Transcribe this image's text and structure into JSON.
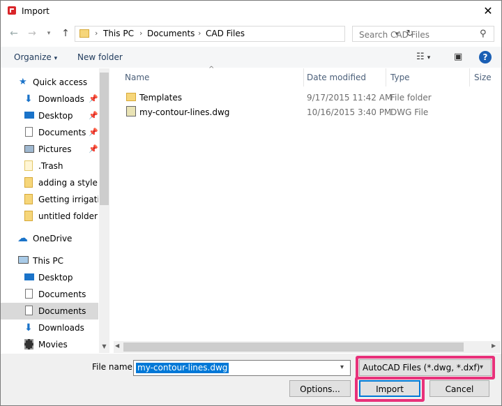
{
  "window": {
    "title": "Import"
  },
  "nav": {
    "breadcrumb": [
      "This PC",
      "Documents",
      "CAD Files"
    ],
    "search_placeholder": "Search CAD Files"
  },
  "toolbar": {
    "organize": "Organize",
    "new_folder": "New folder"
  },
  "sidebar": {
    "items": [
      {
        "label": "Quick access",
        "icon": "star-icon"
      },
      {
        "label": "Downloads",
        "icon": "download-arrow-icon",
        "pinned": true
      },
      {
        "label": "Desktop",
        "icon": "desktop-icon",
        "pinned": true
      },
      {
        "label": "Documents",
        "icon": "document-icon",
        "pinned": true
      },
      {
        "label": "Pictures",
        "icon": "picture-icon",
        "pinned": true
      },
      {
        "label": ".Trash",
        "icon": "folder-icon"
      },
      {
        "label": "adding a style in",
        "icon": "folder-icon"
      },
      {
        "label": "Getting irrigation",
        "icon": "folder-icon"
      },
      {
        "label": "untitled folder",
        "icon": "folder-icon"
      },
      {
        "label": "OneDrive",
        "icon": "cloud-icon"
      },
      {
        "label": "This PC",
        "icon": "computer-icon"
      },
      {
        "label": "Desktop",
        "icon": "desktop-icon"
      },
      {
        "label": "Documents",
        "icon": "document-icon"
      },
      {
        "label": "Documents",
        "icon": "document-icon",
        "selected": true
      },
      {
        "label": "Downloads",
        "icon": "download-arrow-icon"
      },
      {
        "label": "Movies",
        "icon": "film-icon"
      }
    ]
  },
  "columns": {
    "name": "Name",
    "date": "Date modified",
    "type": "Type",
    "size": "Size"
  },
  "files": [
    {
      "name": "Templates",
      "date": "9/17/2015 11:42 AM",
      "type": "File folder",
      "icon": "folder-icon"
    },
    {
      "name": "my-contour-lines.dwg",
      "date": "10/16/2015 3:40 PM",
      "type": "DWG File",
      "icon": "dwg-file-icon"
    }
  ],
  "bottom": {
    "file_name_label": "File name:",
    "file_name_value": "my-contour-lines.dwg",
    "filter": "AutoCAD Files (*.dwg, *.dxf)",
    "options": "Options...",
    "import": "Import",
    "cancel": "Cancel"
  },
  "colors": {
    "highlight": "#e8317a",
    "accent": "#0078d7"
  }
}
